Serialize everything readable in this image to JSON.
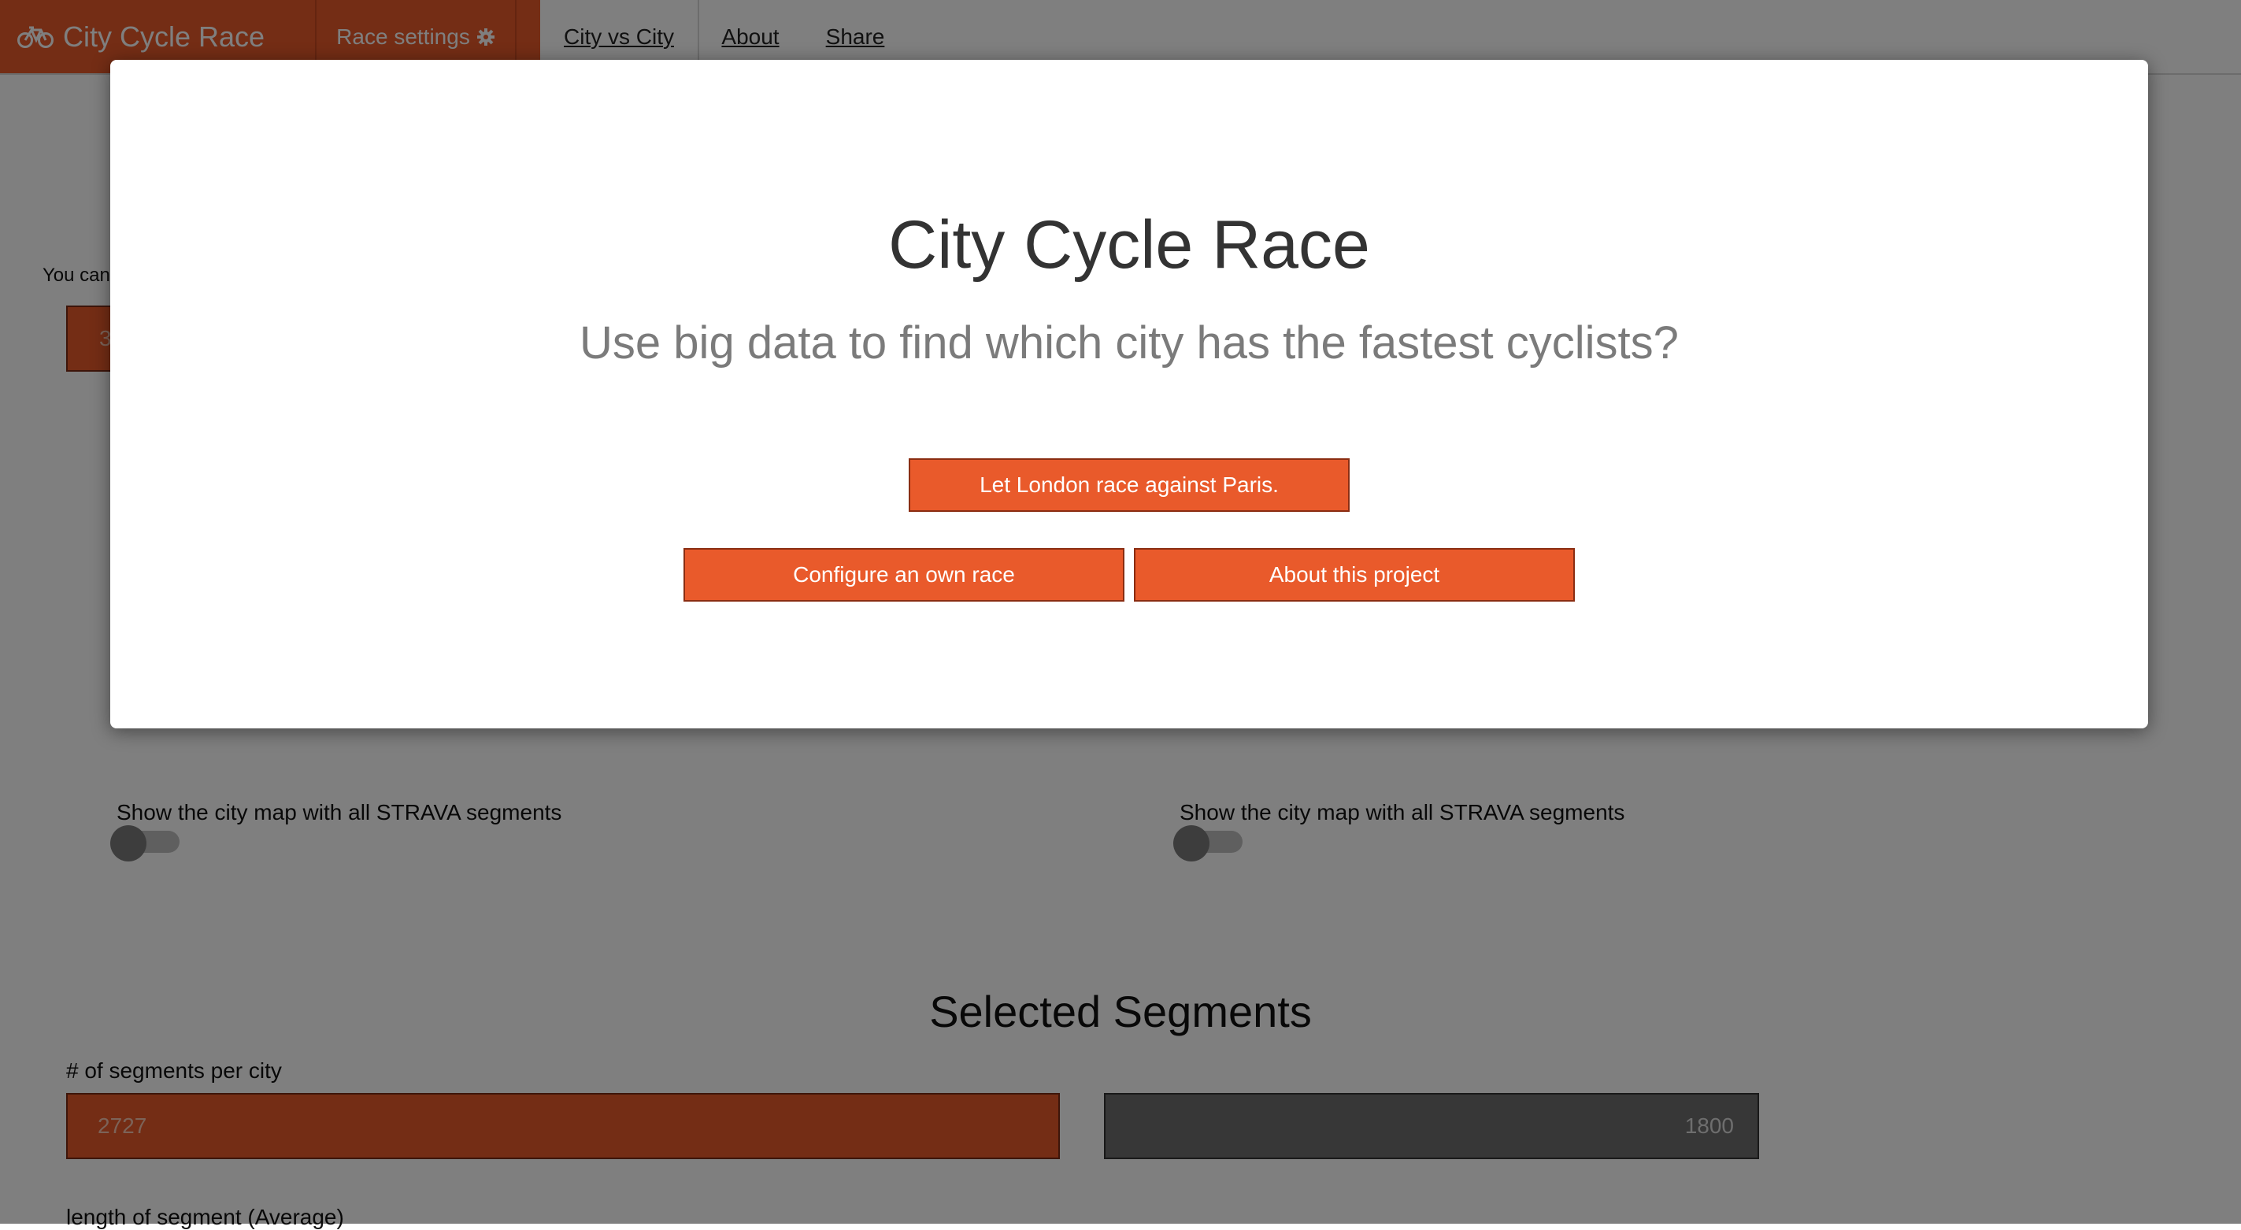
{
  "navbar": {
    "brand": "City Cycle Race",
    "brand_icon": "bicycle-icon",
    "race_settings": "Race settings",
    "race_settings_icon": "gear-icon",
    "links": [
      "City vs City",
      "About",
      "Share"
    ]
  },
  "page": {
    "intro_text": "You can",
    "selected_city_value": "3",
    "left_map_label": "Show the city map with all STRAVA segments",
    "right_map_label": "Show the city map with all STRAVA segments",
    "section_title": "Selected Segments",
    "segments_label": "# of segments per city",
    "segments_city_a": "2727",
    "segments_city_b": "1800",
    "length_label": "length of segment (Average)"
  },
  "modal": {
    "title": "City Cycle Race",
    "subtitle": "Use big data to find which city has the fastest cyclists?",
    "primary_button": "Let London race against Paris.",
    "configure_button": "Configure an own race",
    "about_button": "About this project"
  },
  "colors": {
    "accent": "#e95a2b",
    "overlay": "rgba(0,0,0,0.5)"
  }
}
